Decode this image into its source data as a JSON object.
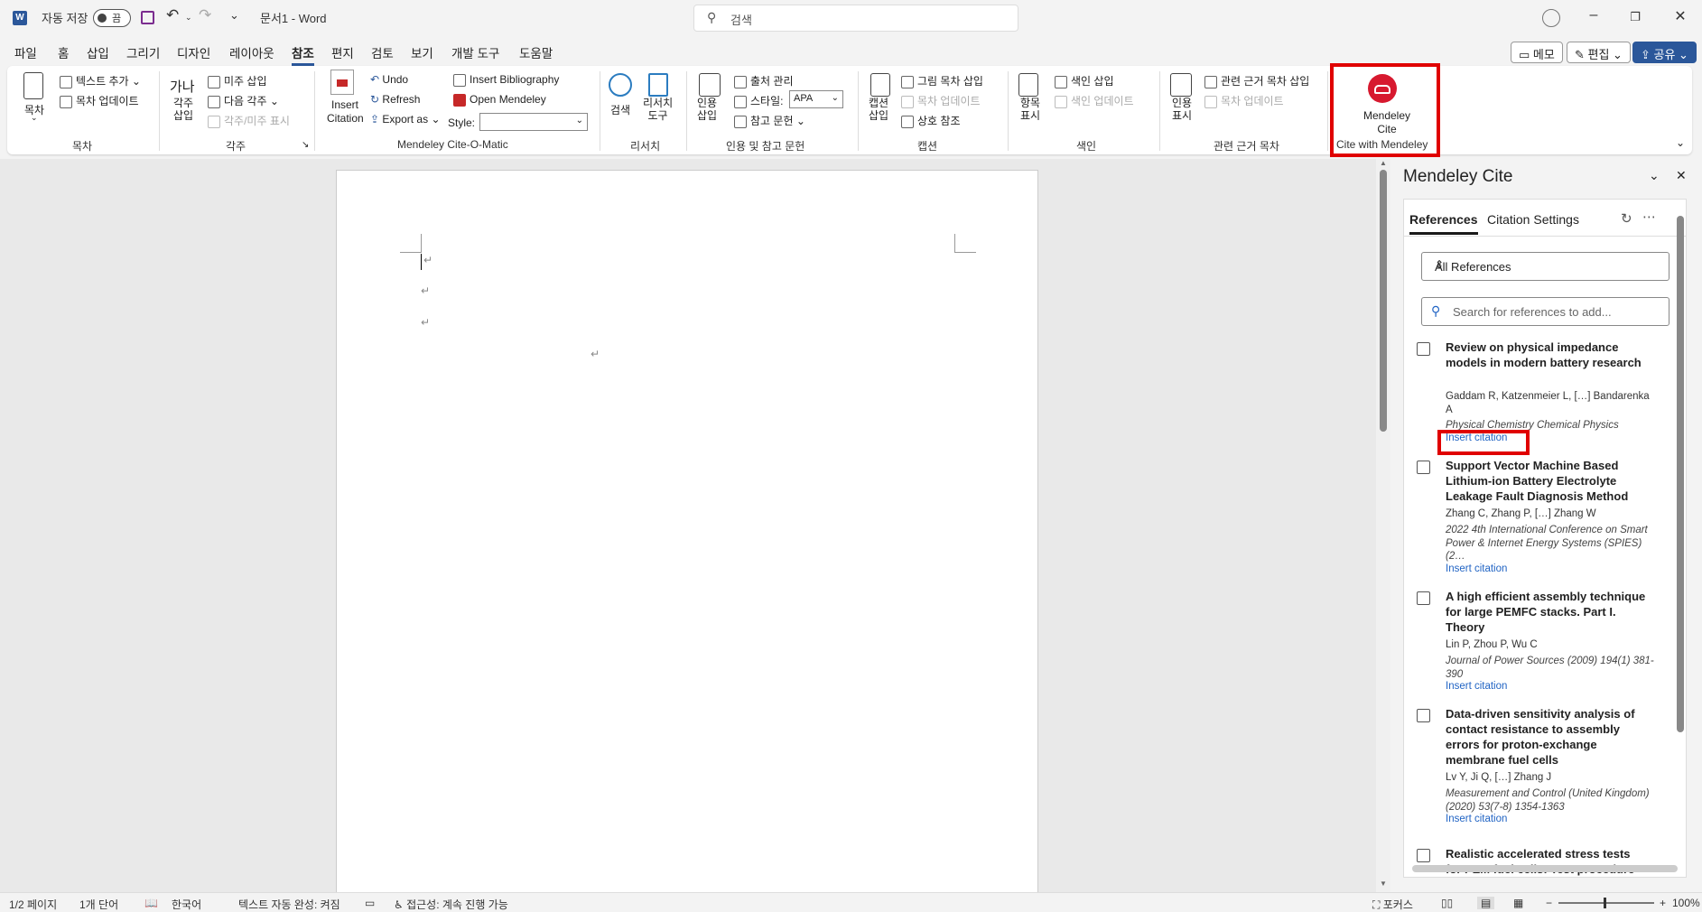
{
  "titlebar": {
    "autosave_label": "자동 저장",
    "autosave_state": "끔",
    "doc_title": "문서1  -  Word",
    "search_placeholder": "검색"
  },
  "menu": [
    "파일",
    "홈",
    "삽입",
    "그리기",
    "디자인",
    "레이아웃",
    "참조",
    "편지",
    "검토",
    "보기",
    "개발 도구",
    "도움말"
  ],
  "menu_active": "참조",
  "right_buttons": {
    "memo": "메모",
    "edit": "편집",
    "share": "공유"
  },
  "ribbon": {
    "toc": {
      "big": "목차",
      "add_text": "텍스트 추가",
      "update": "목차 업데이트",
      "group": "목차"
    },
    "footnote": {
      "big": "각주\n삽입",
      "endnote": "미주 삽입",
      "next": "다음 각주",
      "show": "각주/미주 표시",
      "group": "각주"
    },
    "mendeley": {
      "insert_citation": "Insert Citation",
      "undo": "Undo",
      "refresh": "Refresh",
      "export": "Export as",
      "insert_bib": "Insert Bibliography",
      "open": "Open Mendeley",
      "style_label": "Style:",
      "style_value": "",
      "group": "Mendeley Cite-O-Matic"
    },
    "research": {
      "search": "검색",
      "tool": "리서치\n도구",
      "group": "리서치"
    },
    "citations": {
      "insert": "인용\n삽입",
      "manage": "출처 관리",
      "style_label": "스타일:",
      "style_value": "APA",
      "bib": "참고 문헌",
      "group": "인용 및 참고 문헌"
    },
    "captions": {
      "insert": "캡션\n삽입",
      "figures": "그림 목차 삽입",
      "update": "목차 업데이트",
      "cross": "상호 참조",
      "group": "캡션"
    },
    "index": {
      "mark": "항목\n표시",
      "insert": "색인 삽입",
      "update": "색인 업데이트",
      "group": "색인"
    },
    "authorities": {
      "mark": "인용\n표시",
      "insert": "관련 근거 목차 삽입",
      "update": "목차 업데이트",
      "group": "관련 근거 목차"
    },
    "cite_with_mendeley": {
      "button": "Mendeley\nCite",
      "group": "Cite with Mendeley"
    }
  },
  "panel": {
    "title": "Mendeley Cite",
    "tabs": [
      "References",
      "Citation Settings"
    ],
    "filter": "All References",
    "search_placeholder": "Search for references to add...",
    "insert_label": "Insert citation",
    "refs": [
      {
        "title": "Review on physical impedance models in modern battery research",
        "authors": "Gaddam R, Katzenmeier L, […] Bandarenka A",
        "journal": "Physical Chemistry Chemical Physics"
      },
      {
        "title": "Support Vector Machine Based Lithium-ion Battery Electrolyte Leakage Fault Diagnosis Method",
        "authors": "Zhang C, Zhang P, […] Zhang W",
        "journal": "2022 4th International Conference on Smart Power & Internet Energy Systems (SPIES) (2…"
      },
      {
        "title": "A high efficient assembly technique for large PEMFC stacks. Part I. Theory",
        "authors": "Lin P, Zhou P, Wu C",
        "journal": "Journal of Power Sources (2009) 194(1) 381-390"
      },
      {
        "title": "Data-driven sensitivity analysis of contact resistance to assembly errors for proton-exchange membrane fuel cells",
        "authors": "Lv Y, Ji Q, […] Zhang J",
        "journal": "Measurement and Control (United Kingdom) (2020) 53(7-8) 1354-1363"
      },
      {
        "title": "Realistic accelerated stress tests for PEM fuel cells: Test procedure",
        "authors": "",
        "journal": ""
      }
    ]
  },
  "status": {
    "page": "1/2 페이지",
    "words": "1개 단어",
    "lang": "한국어",
    "autocomplete": "텍스트 자동 완성: 켜짐",
    "accessibility": "접근성: 계속 진행 가능",
    "focus": "포커스",
    "zoom": "100%"
  },
  "colors": {
    "accent": "#2b579a",
    "highlight": "#e00000",
    "mendeley": "#d7192f",
    "link": "#2164c4"
  }
}
